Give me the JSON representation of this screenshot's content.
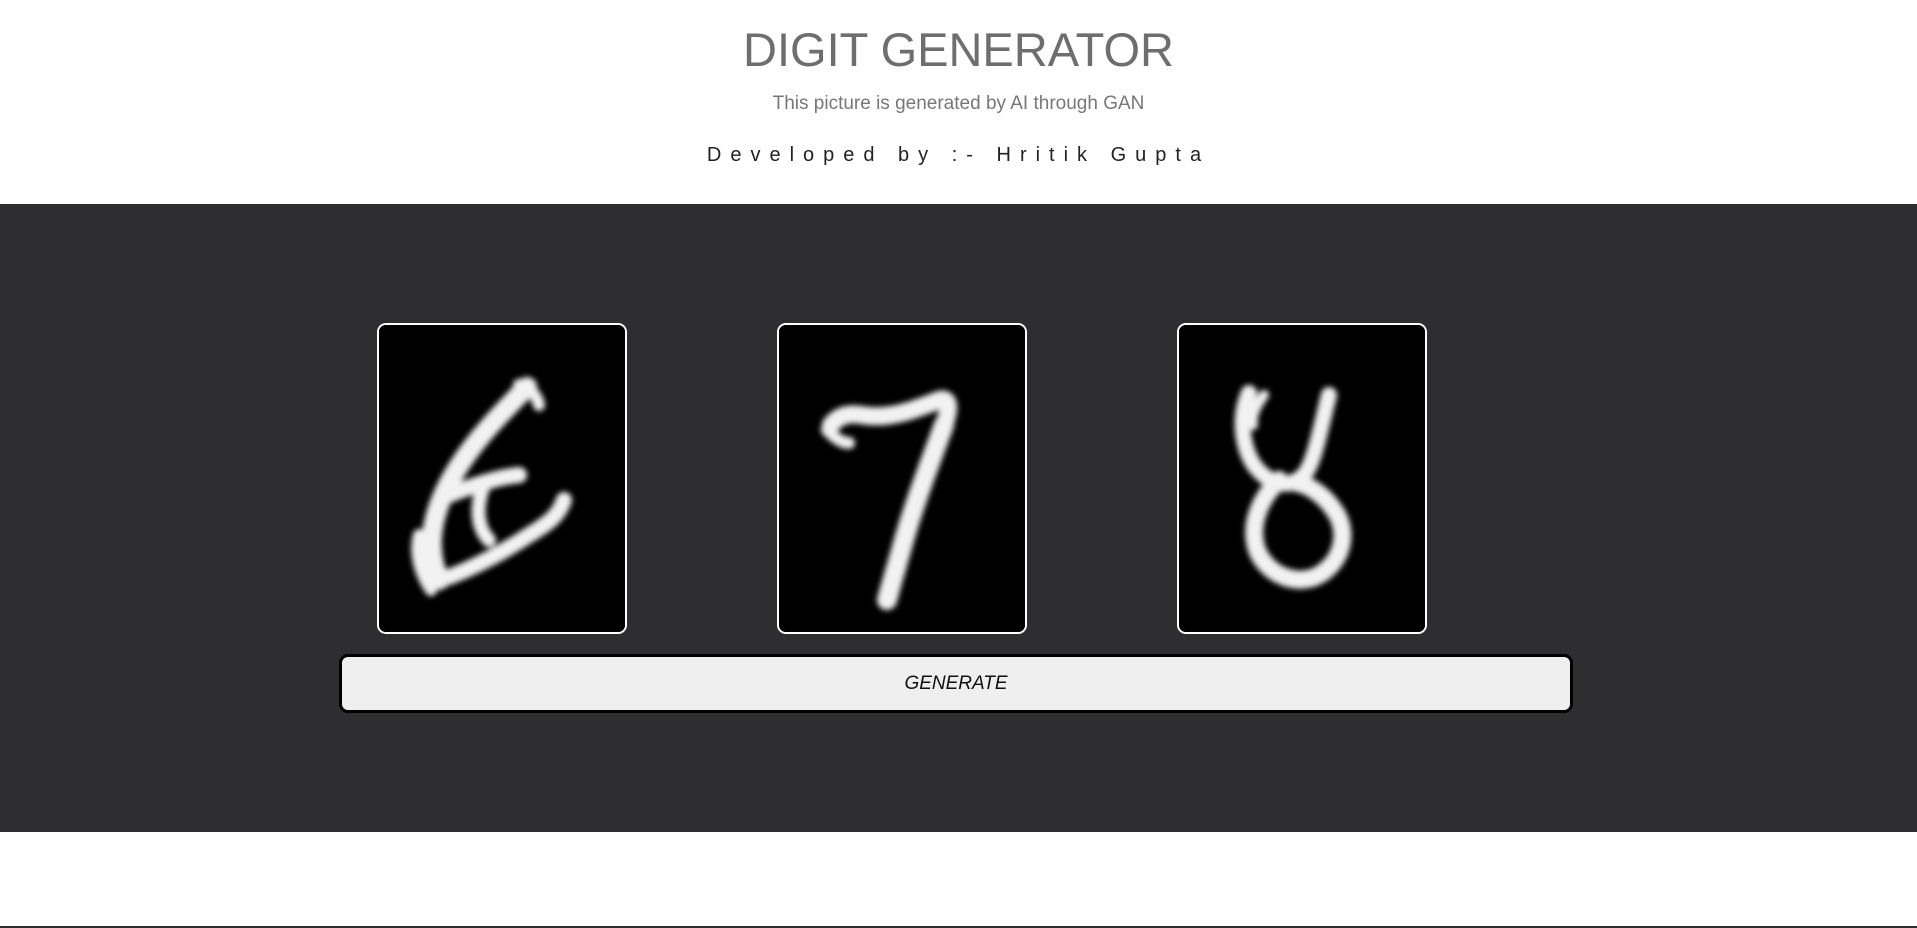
{
  "header": {
    "title": "DIGIT GENERATOR",
    "subtitle": "This picture is generated by AI through GAN",
    "developer": "Developed by :- Hritik Gupta"
  },
  "generated_digits": [
    {
      "label": "6",
      "icon": "handwritten-digit-6"
    },
    {
      "label": "7",
      "icon": "handwritten-digit-7"
    },
    {
      "label": "8",
      "icon": "handwritten-digit-8"
    }
  ],
  "actions": {
    "generate_label": "GENERATE"
  },
  "colors": {
    "stage_background": "#2e2e30",
    "title_text": "#6e6e6e",
    "button_background": "#efefef"
  }
}
